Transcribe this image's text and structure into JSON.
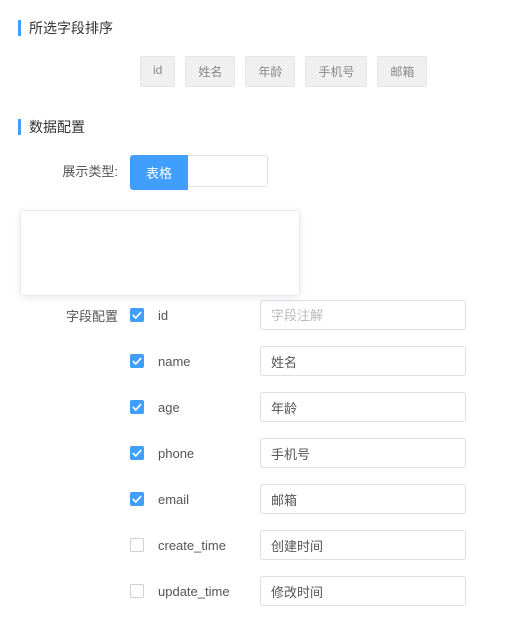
{
  "sections": {
    "sort_title": "所选字段排序",
    "config_title": "数据配置"
  },
  "tags": [
    "id",
    "姓名",
    "年龄",
    "手机号",
    "邮箱"
  ],
  "display_type": {
    "label": "展示类型:",
    "button": "表格"
  },
  "field_config": {
    "label": "字段配置",
    "fields": [
      {
        "name": "id",
        "checked": true,
        "value": "",
        "placeholder": "字段注解"
      },
      {
        "name": "name",
        "checked": true,
        "value": "姓名",
        "placeholder": ""
      },
      {
        "name": "age",
        "checked": true,
        "value": "年龄",
        "placeholder": ""
      },
      {
        "name": "phone",
        "checked": true,
        "value": "手机号",
        "placeholder": ""
      },
      {
        "name": "email",
        "checked": true,
        "value": "邮箱",
        "placeholder": ""
      },
      {
        "name": "create_time",
        "checked": false,
        "value": "创建时间",
        "placeholder": ""
      },
      {
        "name": "update_time",
        "checked": false,
        "value": "修改时间",
        "placeholder": ""
      }
    ]
  }
}
